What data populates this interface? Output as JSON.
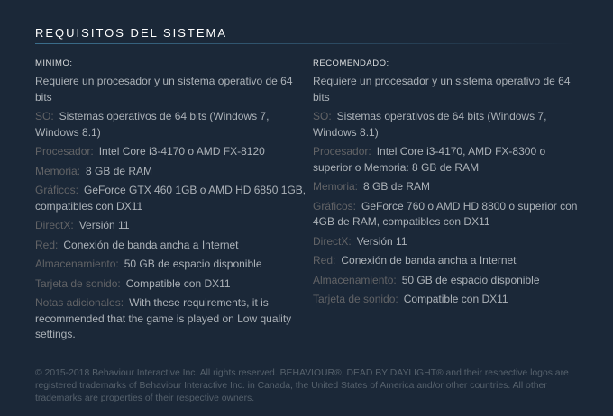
{
  "section": {
    "title": "REQUISITOS DEL SISTEMA"
  },
  "minimum": {
    "heading": "MÍNIMO:",
    "intro": "Requiere un procesador y un sistema operativo de 64 bits",
    "items": [
      {
        "label": "SO:",
        "value": "Sistemas operativos de 64 bits (Windows 7, Windows 8.1)"
      },
      {
        "label": "Procesador:",
        "value": "Intel Core i3-4170 o AMD FX-8120"
      },
      {
        "label": "Memoria:",
        "value": "8 GB de RAM"
      },
      {
        "label": "Gráficos:",
        "value": "GeForce GTX 460 1GB o AMD HD 6850 1GB, compatibles con DX11"
      },
      {
        "label": "DirectX:",
        "value": "Versión 11"
      },
      {
        "label": "Red:",
        "value": "Conexión de banda ancha a Internet"
      },
      {
        "label": "Almacenamiento:",
        "value": "50 GB de espacio disponible"
      },
      {
        "label": "Tarjeta de sonido:",
        "value": "Compatible con DX11"
      },
      {
        "label": "Notas adicionales:",
        "value": "With these requirements, it is recommended that the game is played on Low quality settings."
      }
    ]
  },
  "recommended": {
    "heading": "RECOMENDADO:",
    "intro": "Requiere un procesador y un sistema operativo de 64 bits",
    "items": [
      {
        "label": "SO:",
        "value": "Sistemas operativos de 64 bits (Windows 7, Windows 8.1)"
      },
      {
        "label": "Procesador:",
        "value": "Intel Core i3-4170, AMD FX-8300 o superior o Memoria: 8 GB de RAM"
      },
      {
        "label": "Memoria:",
        "value": "8 GB de RAM"
      },
      {
        "label": "Gráficos:",
        "value": "GeForce 760 o AMD HD 8800 o superior con 4GB de RAM, compatibles con DX11"
      },
      {
        "label": "DirectX:",
        "value": "Versión 11"
      },
      {
        "label": "Red:",
        "value": "Conexión de banda ancha a Internet"
      },
      {
        "label": "Almacenamiento:",
        "value": "50 GB de espacio disponible"
      },
      {
        "label": "Tarjeta de sonido:",
        "value": "Compatible con DX11"
      }
    ]
  },
  "legal": "© 2015-2018 Behaviour Interactive Inc. All rights reserved. BEHAVIOUR®, DEAD BY DAYLIGHT® and their respective logos are registered trademarks of Behaviour Interactive Inc. in Canada, the United States of America and/or other countries. All other trademarks are properties of their respective owners.",
  "colors": {
    "background": "#1b2838",
    "heading": "#ffffff",
    "label": "#626366",
    "value": "#acb2b8",
    "legal": "#56616c"
  }
}
